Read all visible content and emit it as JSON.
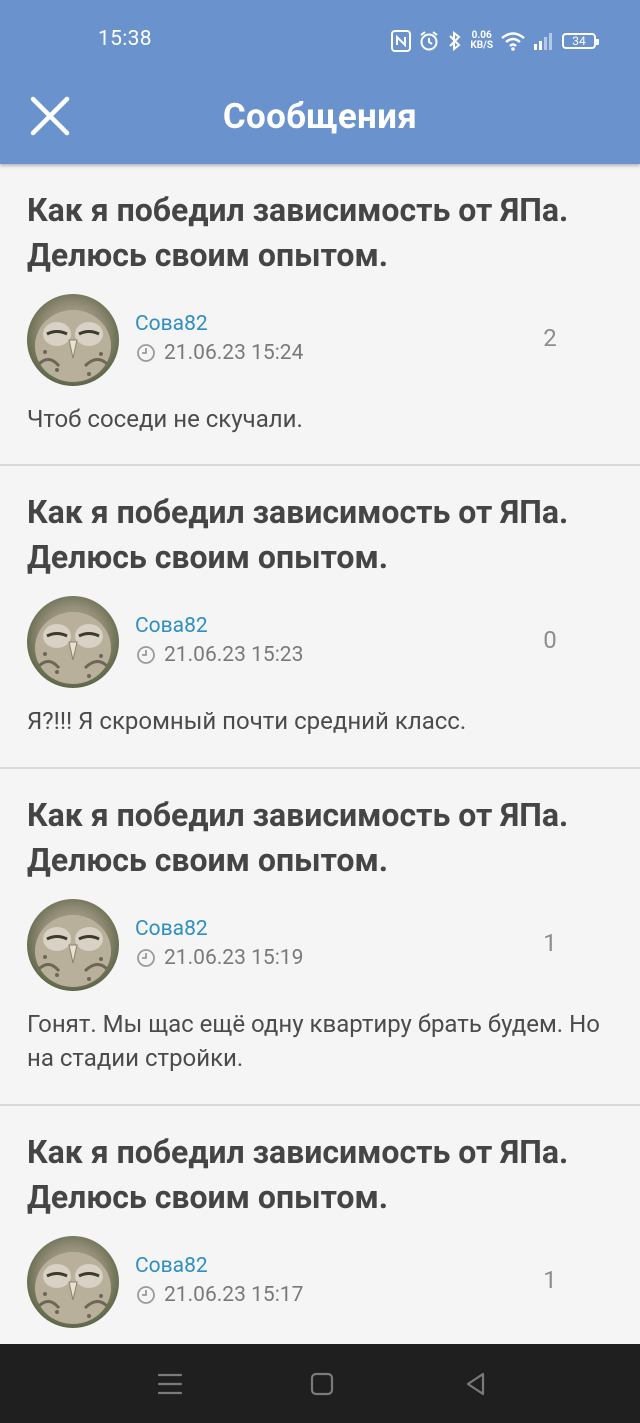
{
  "status_bar": {
    "time": "15:38",
    "net_speed_value": "0.06",
    "net_speed_unit": "KB/S",
    "battery": "34",
    "icons": [
      "nfc-icon",
      "alarm-icon",
      "bluetooth-icon",
      "wifi-icon",
      "signal-icon",
      "battery-icon"
    ]
  },
  "app_bar": {
    "title": "Сообщения",
    "close_icon": "close-icon"
  },
  "colors": {
    "app_bar": "#6a93cd",
    "author_link": "#2f8fc0",
    "title_text": "#454545",
    "nav_bar": "#1f1f1f"
  },
  "posts": [
    {
      "title": "Как я победил зависимость от ЯПа. Делюсь своим опытом.",
      "author": "Сова82",
      "date": "21.06.23 15:24",
      "count": "2",
      "text": "Чтоб соседи не скучали."
    },
    {
      "title": "Как я победил зависимость от ЯПа. Делюсь своим опытом.",
      "author": "Сова82",
      "date": "21.06.23 15:23",
      "count": "0",
      "text": "Я?!!! Я скромный почти средний класс."
    },
    {
      "title": "Как я победил зависимость от ЯПа. Делюсь своим опытом.",
      "author": "Сова82",
      "date": "21.06.23 15:19",
      "count": "1",
      "text": "Гонят. Мы щас ещё одну квартиру брать будем. Но на стадии стройки."
    },
    {
      "title": "Как я победил зависимость от ЯПа. Делюсь своим опытом.",
      "author": "Сова82",
      "date": "21.06.23 15:17",
      "count": "1",
      "text": ""
    }
  ],
  "nav_bar": {
    "icons": [
      "menu-icon",
      "home-icon",
      "back-icon"
    ]
  }
}
